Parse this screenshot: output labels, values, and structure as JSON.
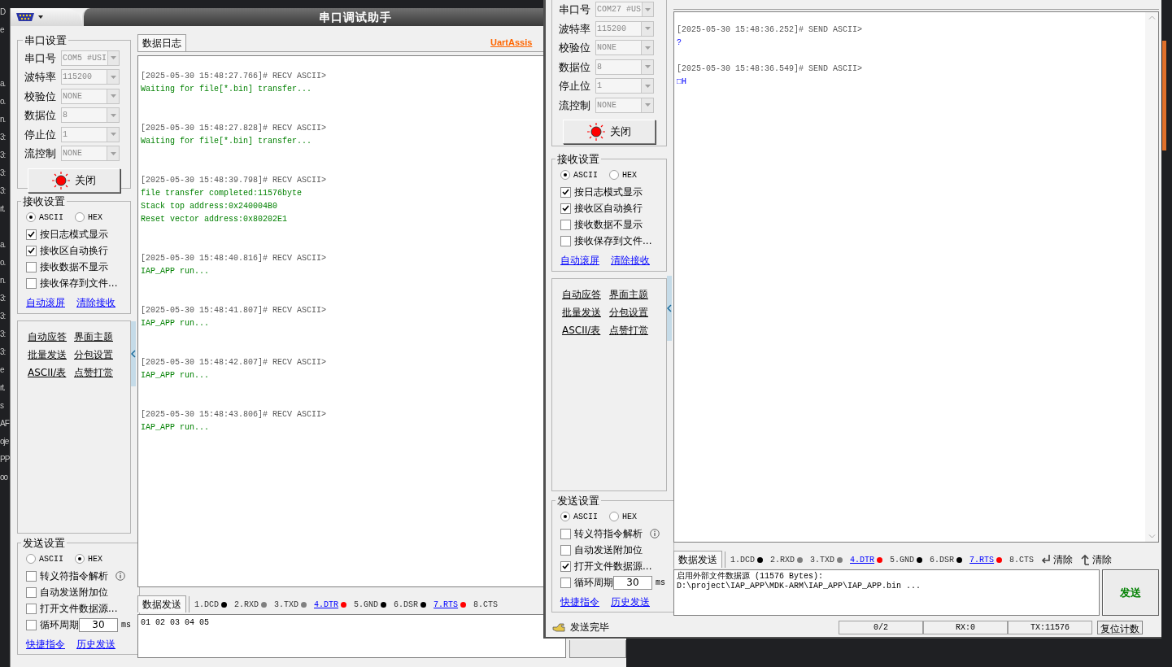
{
  "desktop": {
    "editor_fragments": [
      [
        "D",
        "e"
      ],
      [
        "a.",
        "o.",
        "n.",
        "3:",
        "3:",
        "3:",
        "3:",
        "rt."
      ],
      [
        "a.",
        "o.",
        "n.",
        "3:",
        "3:",
        "3:",
        "3:",
        "e",
        "rt.",
        "s",
        "AF",
        "oje",
        "PP",
        "oo"
      ]
    ]
  },
  "left_window": {
    "title": "串口调试助手",
    "serial_settings": {
      "title": "串口设置",
      "fields": [
        {
          "label": "串口号",
          "value": "COM5 #USI",
          "disabled": true
        },
        {
          "label": "波特率",
          "value": "115200",
          "disabled": true
        },
        {
          "label": "校验位",
          "value": "NONE",
          "disabled": true
        },
        {
          "label": "数据位",
          "value": "8",
          "disabled": true
        },
        {
          "label": "停止位",
          "value": "1",
          "disabled": true
        },
        {
          "label": "流控制",
          "value": "NONE",
          "disabled": true
        }
      ],
      "button": "关闭"
    },
    "receive_settings": {
      "title": "接收设置",
      "modes": [
        {
          "label": "ASCII",
          "selected": true
        },
        {
          "label": "HEX",
          "selected": false
        }
      ],
      "options": [
        {
          "label": "按日志模式显示",
          "checked": true,
          "info": false
        },
        {
          "label": "接收区自动换行",
          "checked": true,
          "info": false
        },
        {
          "label": "接收数据不显示",
          "checked": false,
          "info": false
        },
        {
          "label": "接收保存到文件...",
          "checked": false,
          "info": false
        }
      ],
      "links": [
        "自动滚屏",
        "清除接收"
      ]
    },
    "tools": [
      "自动应答",
      "界面主题",
      "批量发送",
      "分包设置",
      "ASCII/表",
      "点赞打赏"
    ],
    "send_settings": {
      "title": "发送设置",
      "modes": [
        {
          "label": "ASCII",
          "selected": false
        },
        {
          "label": "HEX",
          "selected": true
        }
      ],
      "options": [
        {
          "label": "转义符指令解析",
          "checked": false,
          "info": true
        },
        {
          "label": "自动发送附加位",
          "checked": false,
          "info": false
        },
        {
          "label": "打开文件数据源...",
          "checked": false,
          "info": false
        }
      ],
      "cycle": {
        "label": "循环周期",
        "checked": false,
        "value": "30",
        "unit": "ms"
      },
      "links": [
        "快捷指令",
        "历史发送"
      ]
    },
    "log_tab": "数据日志",
    "brand_link": "UartAssis",
    "log": [
      {
        "kind": "recv",
        "header": "[2025-05-30 15:48:27.766]# RECV ASCII>",
        "lines": [
          "Waiting for file[*.bin] transfer..."
        ]
      },
      {
        "kind": "recv",
        "header": "[2025-05-30 15:48:27.828]# RECV ASCII>",
        "lines": [
          "Waiting for file[*.bin] transfer..."
        ]
      },
      {
        "kind": "recv",
        "header": "[2025-05-30 15:48:39.798]# RECV ASCII>",
        "lines": [
          "file transfer completed:11576byte",
          "Stack top address:0x240004B0",
          "Reset vector address:0x80202E1"
        ]
      },
      {
        "kind": "recv",
        "header": "[2025-05-30 15:48:40.816]# RECV ASCII>",
        "lines": [
          "IAP_APP run..."
        ]
      },
      {
        "kind": "recv",
        "header": "[2025-05-30 15:48:41.807]# RECV ASCII>",
        "lines": [
          "IAP_APP run..."
        ]
      },
      {
        "kind": "recv",
        "header": "[2025-05-30 15:48:42.807]# RECV ASCII>",
        "lines": [
          "IAP_APP run..."
        ]
      },
      {
        "kind": "recv",
        "header": "[2025-05-30 15:48:43.806]# RECV ASCII>",
        "lines": [
          "IAP_APP run..."
        ]
      }
    ],
    "send_tab": "数据发送",
    "signals": [
      {
        "label": "1.DCD",
        "color": "#000000",
        "link": false
      },
      {
        "label": "2.RXD",
        "color": "#808080",
        "link": false
      },
      {
        "label": "3.TXD",
        "color": "#808080",
        "link": false
      },
      {
        "label": "4.DTR",
        "color": "#ff0000",
        "link": true
      },
      {
        "label": "5.GND",
        "color": "#000000",
        "link": false
      },
      {
        "label": "6.DSR",
        "color": "#000000",
        "link": false
      },
      {
        "label": "7.RTS",
        "color": "#ff0000",
        "link": true
      },
      {
        "label": "8.CTS",
        "link": false
      }
    ],
    "send_text": "01 02 03 04 05"
  },
  "right_window": {
    "serial_settings": {
      "fields": [
        {
          "label": "串口号",
          "value": "COM27 #US",
          "disabled": true
        },
        {
          "label": "波特率",
          "value": "115200",
          "disabled": true
        },
        {
          "label": "校验位",
          "value": "NONE",
          "disabled": true
        },
        {
          "label": "数据位",
          "value": "8",
          "disabled": true
        },
        {
          "label": "停止位",
          "value": "1",
          "disabled": true
        },
        {
          "label": "流控制",
          "value": "NONE",
          "disabled": true
        }
      ],
      "button": "关闭"
    },
    "receive_settings": {
      "title": "接收设置",
      "modes": [
        {
          "label": "ASCII",
          "selected": true
        },
        {
          "label": "HEX",
          "selected": false
        }
      ],
      "options": [
        {
          "label": "按日志模式显示",
          "checked": true,
          "info": false
        },
        {
          "label": "接收区自动换行",
          "checked": true,
          "info": false
        },
        {
          "label": "接收数据不显示",
          "checked": false,
          "info": false
        },
        {
          "label": "接收保存到文件...",
          "checked": false,
          "info": false
        }
      ],
      "links": [
        "自动滚屏",
        "清除接收"
      ]
    },
    "tools": [
      "自动应答",
      "界面主题",
      "批量发送",
      "分包设置",
      "ASCII/表",
      "点赞打赏"
    ],
    "send_settings": {
      "title": "发送设置",
      "modes": [
        {
          "label": "ASCII",
          "selected": true
        },
        {
          "label": "HEX",
          "selected": false
        }
      ],
      "options": [
        {
          "label": "转义符指令解析",
          "checked": false,
          "info": true
        },
        {
          "label": "自动发送附加位",
          "checked": false,
          "info": false
        },
        {
          "label": "打开文件数据源...",
          "checked": true,
          "info": false
        }
      ],
      "cycle": {
        "label": "循环周期",
        "checked": false,
        "value": "30",
        "unit": "ms"
      },
      "links": [
        "快捷指令",
        "历史发送"
      ]
    },
    "log": [
      {
        "kind": "send",
        "header": "[2025-05-30 15:48:36.252]# SEND ASCII>",
        "lines": [
          "?"
        ]
      },
      {
        "kind": "send",
        "header": "[2025-05-30 15:48:36.549]# SEND ASCII>",
        "lines": [
          "□H"
        ]
      }
    ],
    "send_tab": "数据发送",
    "signals": [
      {
        "label": "1.DCD",
        "color": "#000000",
        "link": false
      },
      {
        "label": "2.RXD",
        "color": "#808080",
        "link": false
      },
      {
        "label": "3.TXD",
        "color": "#808080",
        "link": false
      },
      {
        "label": "4.DTR",
        "color": "#ff0000",
        "link": true
      },
      {
        "label": "5.GND",
        "color": "#000000",
        "link": false
      },
      {
        "label": "6.DSR",
        "color": "#000000",
        "link": false
      },
      {
        "label": "7.RTS",
        "color": "#ff0000",
        "link": true
      },
      {
        "label": "8.CTS",
        "link": false
      }
    ],
    "clear_buttons": [
      "清除",
      "清除"
    ],
    "send_text_lines": [
      "启用外部文件数据源 (11576 Bytes):",
      "D:\\project\\IAP_APP\\MDK-ARM\\IAP_APP\\IAP_APP.bin ..."
    ],
    "send_button": "发送",
    "status": {
      "message": "发送完毕",
      "counters": [
        "0/2",
        "RX:0",
        "TX:11576"
      ],
      "reset_button": "复位计数"
    }
  }
}
